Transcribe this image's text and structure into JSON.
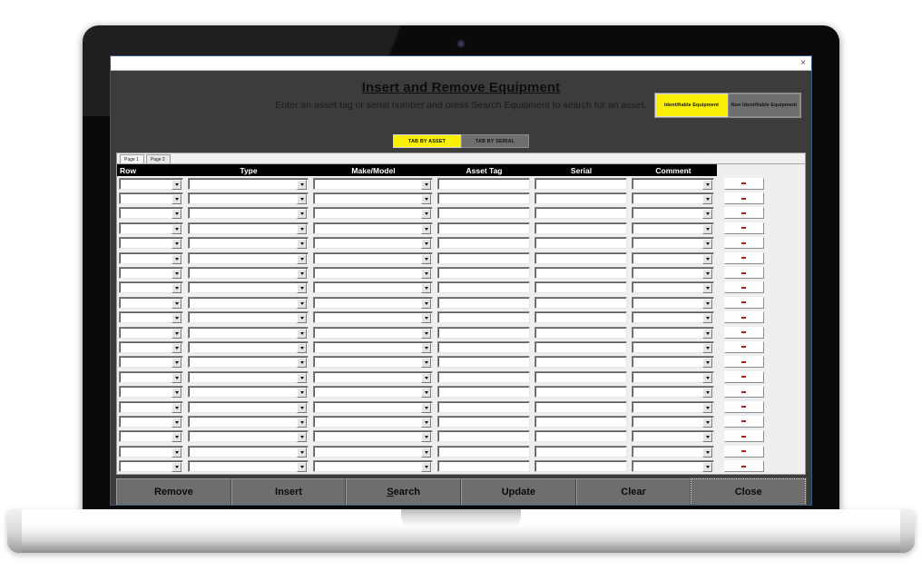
{
  "window": {
    "title": "Insert and Remove Equipment",
    "close_label": "×"
  },
  "header": {
    "title": "Insert and Remove Equipment",
    "subtitle": "Enter an asset tag or serial number and press Search Equipment to search for an asset.",
    "equipment_buttons": [
      {
        "label": "Identifiable Equipment",
        "state": "active",
        "color": "#faf006"
      },
      {
        "label": "Non Identifiable Equipment",
        "state": "inactive",
        "color": "#6e6e6e"
      }
    ],
    "tab_by_buttons": [
      {
        "label": "TAB BY ASSET",
        "state": "active",
        "color": "#faf006"
      },
      {
        "label": "TAB BY SERIAL",
        "state": "inactive",
        "color": "#6e6e6e"
      }
    ]
  },
  "grid": {
    "page_tabs": [
      {
        "label": "Page 1",
        "selected": true
      },
      {
        "label": "Page 2",
        "selected": false
      }
    ],
    "columns": [
      {
        "key": "row",
        "label": "Row",
        "align": "left",
        "control": "combo"
      },
      {
        "key": "type",
        "label": "Type",
        "align": "center",
        "control": "combo"
      },
      {
        "key": "make",
        "label": "Make/Model",
        "align": "center",
        "control": "combo"
      },
      {
        "key": "asset",
        "label": "Asset Tag",
        "align": "center",
        "control": "text"
      },
      {
        "key": "serial",
        "label": "Serial",
        "align": "center",
        "control": "text"
      },
      {
        "key": "comment",
        "label": "Comment",
        "align": "center",
        "control": "combo"
      }
    ],
    "delete_button": {
      "icon": "minus-icon",
      "color": "#c31414"
    },
    "row_count": 20,
    "rows": [
      {
        "row": "",
        "type": "",
        "make": "",
        "asset": "",
        "serial": "",
        "comment": ""
      },
      {
        "row": "",
        "type": "",
        "make": "",
        "asset": "",
        "serial": "",
        "comment": ""
      },
      {
        "row": "",
        "type": "",
        "make": "",
        "asset": "",
        "serial": "",
        "comment": ""
      },
      {
        "row": "",
        "type": "",
        "make": "",
        "asset": "",
        "serial": "",
        "comment": ""
      },
      {
        "row": "",
        "type": "",
        "make": "",
        "asset": "",
        "serial": "",
        "comment": ""
      },
      {
        "row": "",
        "type": "",
        "make": "",
        "asset": "",
        "serial": "",
        "comment": ""
      },
      {
        "row": "",
        "type": "",
        "make": "",
        "asset": "",
        "serial": "",
        "comment": ""
      },
      {
        "row": "",
        "type": "",
        "make": "",
        "asset": "",
        "serial": "",
        "comment": ""
      },
      {
        "row": "",
        "type": "",
        "make": "",
        "asset": "",
        "serial": "",
        "comment": ""
      },
      {
        "row": "",
        "type": "",
        "make": "",
        "asset": "",
        "serial": "",
        "comment": ""
      },
      {
        "row": "",
        "type": "",
        "make": "",
        "asset": "",
        "serial": "",
        "comment": ""
      },
      {
        "row": "",
        "type": "",
        "make": "",
        "asset": "",
        "serial": "",
        "comment": ""
      },
      {
        "row": "",
        "type": "",
        "make": "",
        "asset": "",
        "serial": "",
        "comment": ""
      },
      {
        "row": "",
        "type": "",
        "make": "",
        "asset": "",
        "serial": "",
        "comment": ""
      },
      {
        "row": "",
        "type": "",
        "make": "",
        "asset": "",
        "serial": "",
        "comment": ""
      },
      {
        "row": "",
        "type": "",
        "make": "",
        "asset": "",
        "serial": "",
        "comment": ""
      },
      {
        "row": "",
        "type": "",
        "make": "",
        "asset": "",
        "serial": "",
        "comment": ""
      },
      {
        "row": "",
        "type": "",
        "make": "",
        "asset": "",
        "serial": "",
        "comment": ""
      },
      {
        "row": "",
        "type": "",
        "make": "",
        "asset": "",
        "serial": "",
        "comment": ""
      },
      {
        "row": "",
        "type": "",
        "make": "",
        "asset": "",
        "serial": "",
        "comment": ""
      }
    ]
  },
  "footer": {
    "buttons": [
      {
        "label": "Remove",
        "accel": "",
        "focused": false
      },
      {
        "label": "Insert",
        "accel": "",
        "focused": false
      },
      {
        "label": "Search",
        "accel": "S",
        "focused": false
      },
      {
        "label": "Update",
        "accel": "",
        "focused": false
      },
      {
        "label": "Clear",
        "accel": "",
        "focused": false
      },
      {
        "label": "Close",
        "accel": "",
        "focused": true
      }
    ]
  },
  "device": {
    "type": "laptop",
    "bezel_color": "#0a0a0a",
    "base_color": "#e8e8e8",
    "webcam": "webcam-icon"
  }
}
